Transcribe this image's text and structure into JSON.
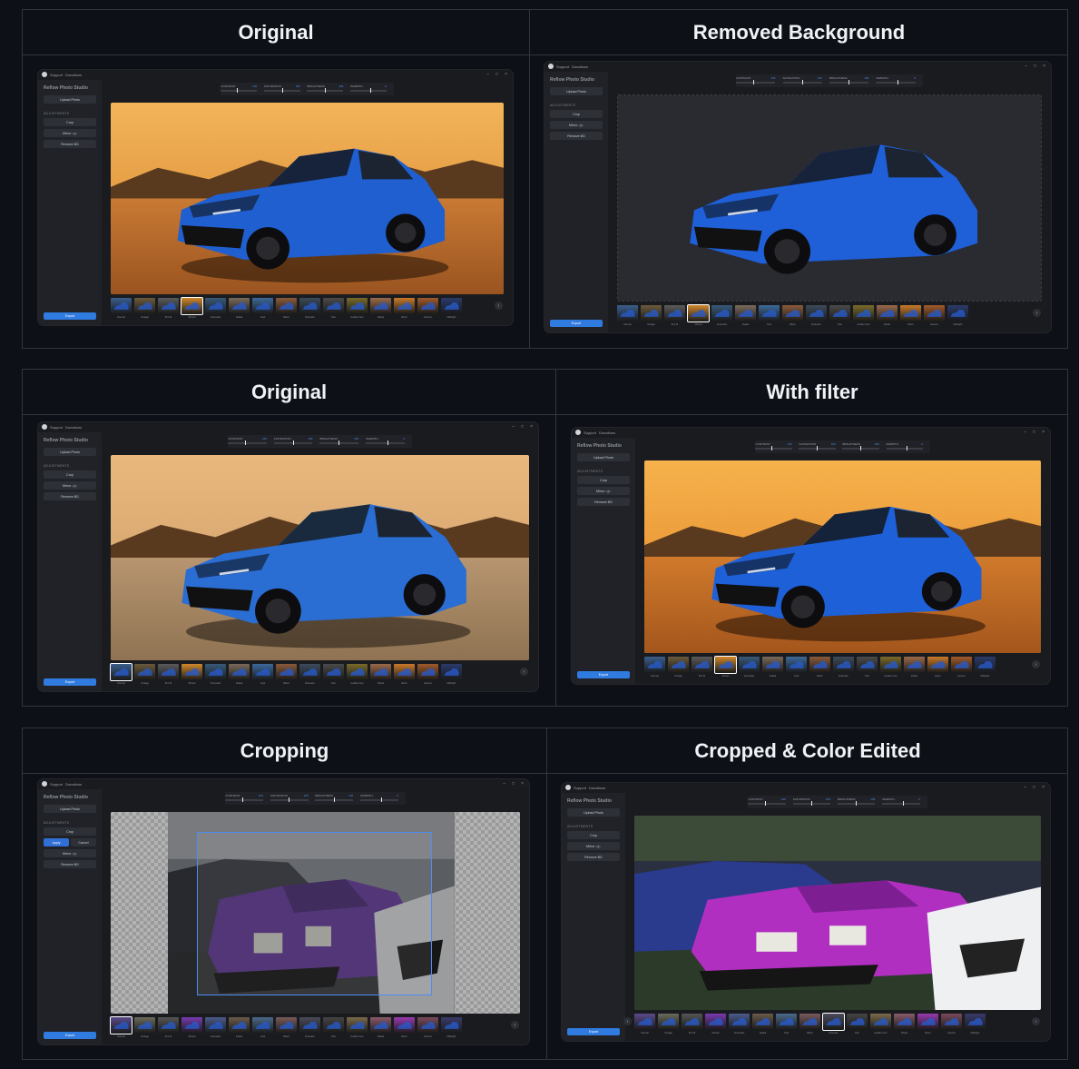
{
  "headers": [
    "Original",
    "Removed Background",
    "Original",
    "With filter",
    "Cropping",
    "Cropped & Color Edited"
  ],
  "app": {
    "menu1": "Support",
    "menu2": "Donations",
    "brand": "Reflow Photo Studio",
    "upload": "Upload Photo",
    "adjustments": "ADJUSTMENTS",
    "crop": "Crop",
    "mirror": "Mirror ◁▷",
    "remove_bg": "Remove BG",
    "apply": "Apply",
    "cancel": "Cancel",
    "export": "Export",
    "sliders": [
      {
        "name": "CONTRAST",
        "value": "125"
      },
      {
        "name": "SATURATION",
        "value": "105"
      },
      {
        "name": "BRIGHTNESS",
        "value": "105"
      },
      {
        "name": "WARMTH",
        "value": "0"
      }
    ],
    "filters": [
      "Normal",
      "Vintage",
      "B & W",
      "Vibrant",
      "Cinematic",
      "Faded",
      "Cool",
      "Warm",
      "Dramatic",
      "Noir",
      "Golden hour",
      "Pastel",
      "Retro",
      "Autumn",
      "Midnight"
    ]
  },
  "colors": {
    "accent": "#2f7be0",
    "car_blue": "#1f5fcf",
    "car_purple": "#8a3fc4"
  }
}
